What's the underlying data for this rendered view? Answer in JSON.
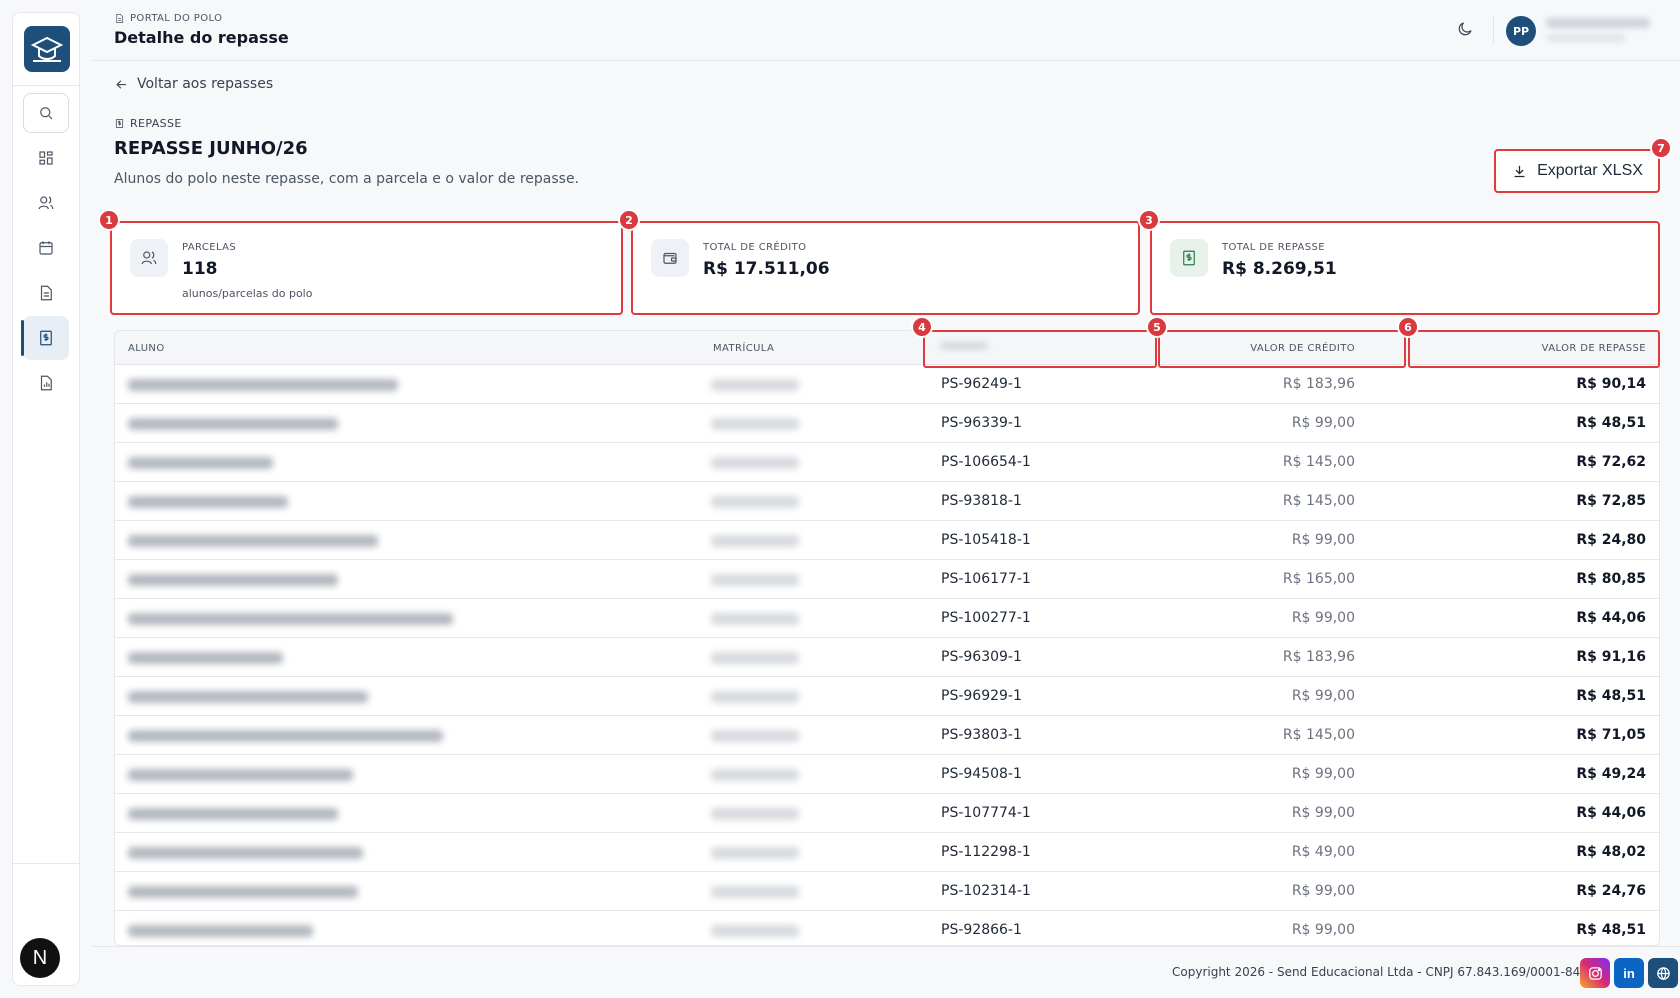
{
  "topbar": {
    "breadcrumb": "PORTAL DO POLO",
    "title": "Detalhe do repasse",
    "avatar_initials": "PP",
    "icons": [
      "moon-icon"
    ]
  },
  "back_link": "Voltar aos repasses",
  "section_label": "REPASSE",
  "repasse_title": "REPASSE JUNHO/26",
  "repasse_subtitle": "Alunos do polo neste repasse, com a parcela e o valor de repasse.",
  "export_button": "Exportar XLSX",
  "badges": [
    "1",
    "2",
    "3",
    "4",
    "5",
    "6",
    "7"
  ],
  "cards": [
    {
      "label": "PARCELAS",
      "value": "118",
      "note": "alunos/parcelas do polo",
      "icon": "users-icon"
    },
    {
      "label": "TOTAL DE CRÉDITO",
      "value": "R$ 17.511,06",
      "note": "",
      "icon": "wallet-icon"
    },
    {
      "label": "TOTAL DE REPASSE",
      "value": "R$ 8.269,51",
      "note": "",
      "icon": "dollar-doc-icon"
    }
  ],
  "table": {
    "headers": {
      "aluno": "ALUNO",
      "matricula": "MATRÍCULA",
      "parcela": "",
      "valor_credito": "VALOR DE CRÉDITO",
      "valor_repasse": "VALOR DE REPASSE"
    },
    "rows": [
      {
        "parcela": "PS-96249-1",
        "credito": "R$ 183,96",
        "repasse": "R$ 90,14"
      },
      {
        "parcela": "PS-96339-1",
        "credito": "R$ 99,00",
        "repasse": "R$ 48,51"
      },
      {
        "parcela": "PS-106654-1",
        "credito": "R$ 145,00",
        "repasse": "R$ 72,62"
      },
      {
        "parcela": "PS-93818-1",
        "credito": "R$ 145,00",
        "repasse": "R$ 72,85"
      },
      {
        "parcela": "PS-105418-1",
        "credito": "R$ 99,00",
        "repasse": "R$ 24,80"
      },
      {
        "parcela": "PS-106177-1",
        "credito": "R$ 165,00",
        "repasse": "R$ 80,85"
      },
      {
        "parcela": "PS-100277-1",
        "credito": "R$ 99,00",
        "repasse": "R$ 44,06"
      },
      {
        "parcela": "PS-96309-1",
        "credito": "R$ 183,96",
        "repasse": "R$ 91,16"
      },
      {
        "parcela": "PS-96929-1",
        "credito": "R$ 99,00",
        "repasse": "R$ 48,51"
      },
      {
        "parcela": "PS-93803-1",
        "credito": "R$ 145,00",
        "repasse": "R$ 71,05"
      },
      {
        "parcela": "PS-94508-1",
        "credito": "R$ 99,00",
        "repasse": "R$ 49,24"
      },
      {
        "parcela": "PS-107774-1",
        "credito": "R$ 99,00",
        "repasse": "R$ 44,06"
      },
      {
        "parcela": "PS-112298-1",
        "credito": "R$ 49,00",
        "repasse": "R$ 48,02"
      },
      {
        "parcela": "PS-102314-1",
        "credito": "R$ 99,00",
        "repasse": "R$ 24,76"
      },
      {
        "parcela": "PS-92866-1",
        "credito": "R$ 99,00",
        "repasse": "R$ 48,51"
      }
    ]
  },
  "footer": {
    "copyright": "Copyright 2026 - Send Educacional Ltda - CNPJ 67.843.169/0001-84",
    "social": [
      "instagram-icon",
      "linkedin-icon",
      "globe-icon"
    ],
    "linkedin_label": "in"
  },
  "sidebar": {
    "items": [
      "search-icon",
      "dashboard-icon",
      "users-icon",
      "calendar-icon",
      "document-icon",
      "dollar-doc-icon",
      "report-icon"
    ],
    "active_item": "dollar-doc-icon",
    "bottom_label": "N"
  },
  "colors": {
    "brand": "#1e4f7a",
    "highlight": "#e0393e",
    "instagram": "#d62976",
    "linkedin": "#0a66c2",
    "globe": "#1e4f7a"
  }
}
